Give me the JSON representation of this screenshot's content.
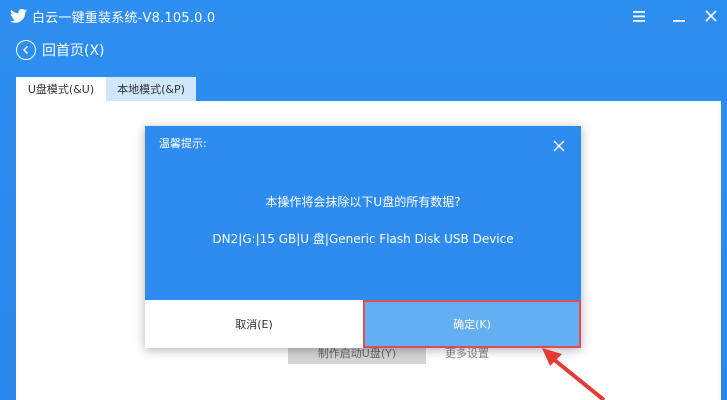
{
  "titlebar": {
    "title": "白云一键重装系统-V8.105.0.0",
    "menu_icon": "hamburger-menu-icon",
    "minimize_icon": "minimize-icon",
    "close_icon": "close-icon"
  },
  "nav": {
    "back_label": "回首页(X)",
    "back_icon": "arrow-left-circle-icon"
  },
  "tabs": [
    {
      "label": "U盘模式(&U)",
      "active": true
    },
    {
      "label": "本地模式(&P)",
      "active": false
    }
  ],
  "background_buttons": {
    "make_boot": "制作启动U盘(Y)",
    "more_settings": "更多设置"
  },
  "dialog": {
    "title": "温馨提示:",
    "message": "本操作将会抹除以下U盘的所有数据?",
    "device": "DN2|G:|15 GB|U 盘|Generic Flash Disk USB Device",
    "cancel_label": "取消(E)",
    "ok_label": "确定(K)"
  },
  "colors": {
    "accent": "#2e8cf0",
    "header": "#2b8ef0",
    "ok_button": "#64aef2",
    "highlight": "#e14b55",
    "annotation_arrow": "#e53935"
  }
}
